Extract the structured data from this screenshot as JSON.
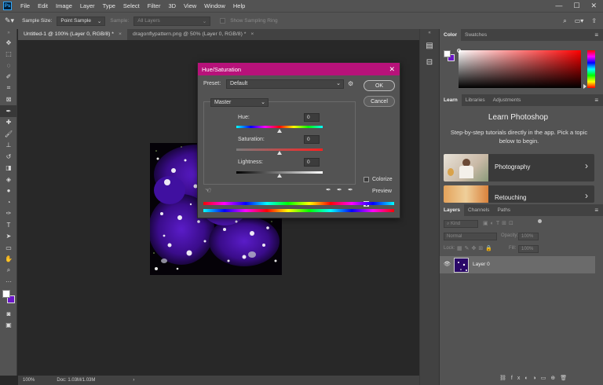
{
  "menubar": {
    "items": [
      "File",
      "Edit",
      "Image",
      "Layer",
      "Type",
      "Select",
      "Filter",
      "3D",
      "View",
      "Window",
      "Help"
    ]
  },
  "options": {
    "sample_size_label": "Sample Size:",
    "sample_size_value": "Point Sample",
    "sample_label": "Sample:",
    "sample_value": "All Layers",
    "show_ring_label": "Show Sampling Ring"
  },
  "tabs": [
    {
      "label": "Untitled-1 @ 100% (Layer 0, RGB/8) *"
    },
    {
      "label": "dragonflypattern.png @ 50% (Layer 0, RGB/8) *"
    }
  ],
  "status": {
    "zoom": "100%",
    "doc": "Doc: 1.03M/1.03M"
  },
  "color_panel": {
    "tabs": [
      "Color",
      "Swatches"
    ]
  },
  "learn_panel": {
    "tabs": [
      "Learn",
      "Libraries",
      "Adjustments"
    ],
    "title": "Learn Photoshop",
    "description": "Step-by-step tutorials directly in the app. Pick a topic below to begin.",
    "cards": [
      {
        "label": "Photography"
      },
      {
        "label": "Retouching"
      }
    ]
  },
  "layers_panel": {
    "tabs": [
      "Layers",
      "Channels",
      "Paths"
    ],
    "kind": "Kind",
    "blend_mode": "Normal",
    "opacity_label": "Opacity:",
    "opacity_value": "100%",
    "lock_label": "Lock:",
    "fill_label": "Fill:",
    "fill_value": "100%",
    "layer_name": "Layer 0"
  },
  "dialog": {
    "title": "Hue/Saturation",
    "preset_label": "Preset:",
    "preset_value": "Default",
    "channel_value": "Master",
    "hue_label": "Hue:",
    "hue_value": "0",
    "saturation_label": "Saturation:",
    "saturation_value": "0",
    "lightness_label": "Lightness:",
    "lightness_value": "0",
    "ok_label": "OK",
    "cancel_label": "Cancel",
    "colorize_label": "Colorize",
    "preview_label": "Preview",
    "colorize_checked": false,
    "preview_checked": true
  },
  "colors": {
    "title_bar": "#b7127a",
    "foreground": "#ffffff",
    "background": "#6a16c8"
  }
}
